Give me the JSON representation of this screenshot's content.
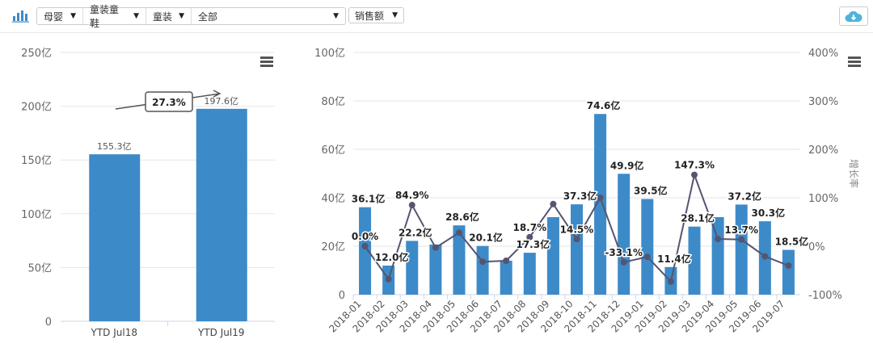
{
  "toolbar": {
    "filters": [
      {
        "label": "母婴"
      },
      {
        "label": "童装童鞋"
      },
      {
        "label": "童装"
      },
      {
        "label": "全部"
      }
    ],
    "metric": "销售额",
    "arrow": "▼",
    "icons": {
      "chart": "bar-chart-icon",
      "download": "cloud-download-icon",
      "menu": "hamburger-menu-icon"
    }
  },
  "colors": {
    "bar": "#3d8ac9",
    "line": "#555570",
    "grid": "#e6e6e6",
    "axis_text": "#666666",
    "download": "#4fb3d9"
  },
  "chart_data": [
    {
      "type": "bar",
      "title": "",
      "categories": [
        "YTD Jul18",
        "YTD Jul19"
      ],
      "values": [
        155.3,
        197.6
      ],
      "value_labels": [
        "155.3亿",
        "197.6亿"
      ],
      "unit": "亿",
      "ylim": [
        0,
        250
      ],
      "yticks": [
        "0",
        "50亿",
        "100亿",
        "150亿",
        "200亿",
        "250亿"
      ],
      "annotation": "27.3%",
      "grid": true
    },
    {
      "type": "bar+line",
      "categories": [
        "2018-01",
        "2018-02",
        "2018-03",
        "2018-04",
        "2018-05",
        "2018-06",
        "2018-07",
        "2018-08",
        "2018-09",
        "2018-10",
        "2018-11",
        "2018-12",
        "2019-01",
        "2019-02",
        "2019-03",
        "2019-04",
        "2019-05",
        "2019-06",
        "2019-07"
      ],
      "series": [
        {
          "name": "销售额",
          "type": "bar",
          "axis": "left",
          "values": [
            36.1,
            12.0,
            22.2,
            20.7,
            28.6,
            20.1,
            14.0,
            17.3,
            32.0,
            37.3,
            74.6,
            49.9,
            39.5,
            11.4,
            28.1,
            32.0,
            37.2,
            30.3,
            18.5
          ],
          "labels": [
            "36.1亿",
            "12.0亿",
            "22.2亿",
            "",
            "28.6亿",
            "20.1亿",
            "",
            "17.3亿",
            "",
            "37.3亿",
            "74.6亿",
            "49.9亿",
            "39.5亿",
            "11.4亿",
            "28.1亿",
            "",
            "37.2亿",
            "30.3亿",
            "18.5亿"
          ]
        },
        {
          "name": "增长率",
          "type": "line",
          "axis": "right",
          "values": [
            0.0,
            -68,
            84.9,
            -3,
            28,
            -32,
            -30,
            18.7,
            87,
            14.5,
            100,
            -33.1,
            -22,
            -73,
            147.3,
            15,
            13.7,
            -21,
            -40
          ],
          "labels": [
            "0.0%",
            "",
            "84.9%",
            "",
            "",
            "",
            "",
            "18.7%",
            "",
            "14.5%",
            "",
            "-33.1%",
            "",
            "",
            "147.3%",
            "",
            "13.7%",
            "",
            ""
          ]
        }
      ],
      "ylim_left": [
        0,
        100
      ],
      "yticks_left": [
        "0",
        "20亿",
        "40亿",
        "60亿",
        "80亿",
        "100亿"
      ],
      "ylim_right": [
        -100,
        400
      ],
      "yticks_right": [
        "-100%",
        "0%",
        "100%",
        "200%",
        "300%",
        "400%"
      ],
      "ylabel_right": "增长率",
      "grid": true
    }
  ]
}
